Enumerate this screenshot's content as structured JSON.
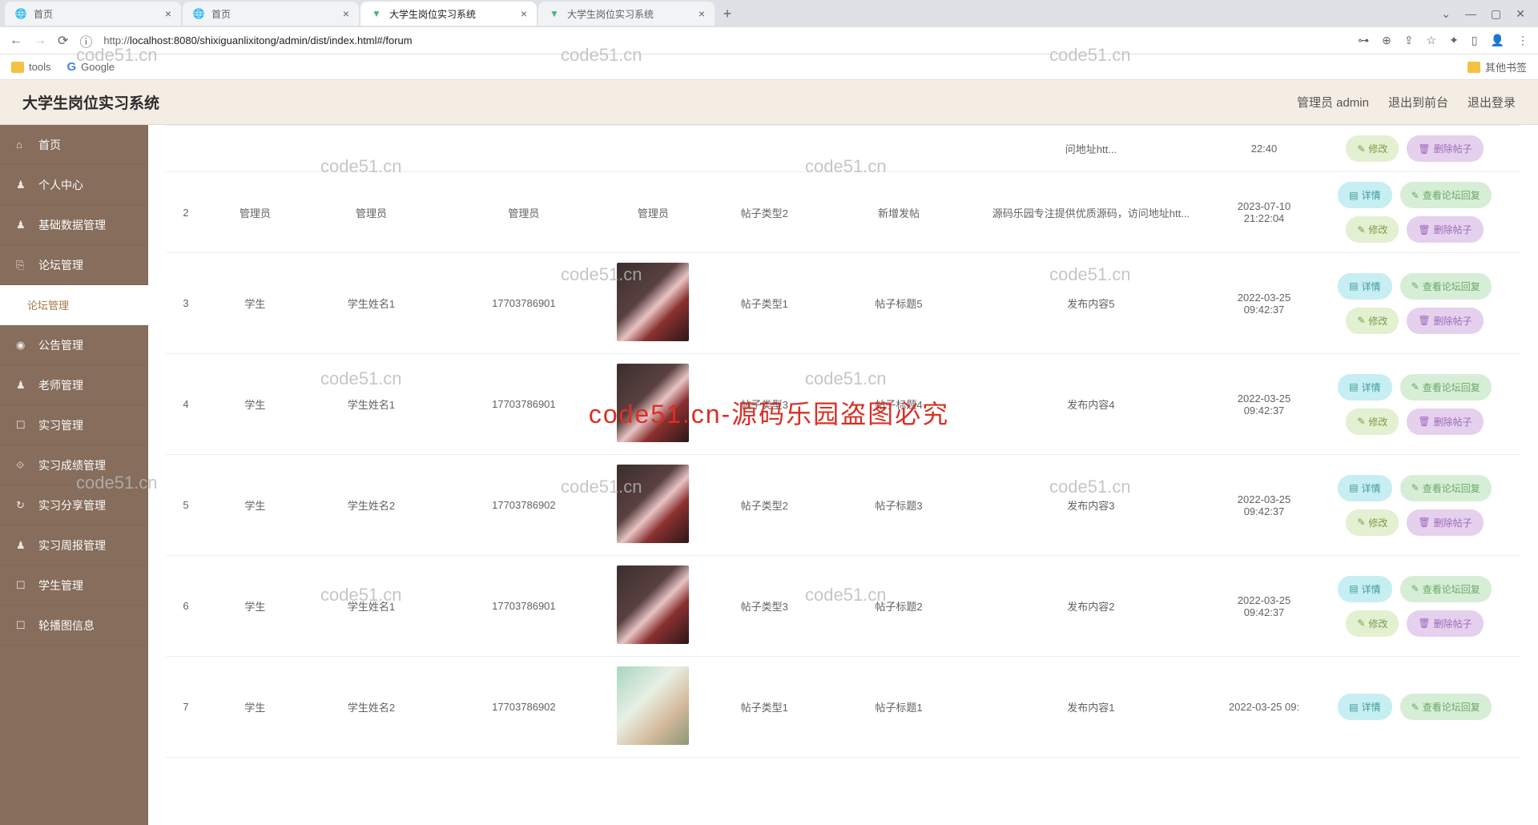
{
  "browser": {
    "tabs": [
      {
        "title": "首页",
        "active": false,
        "icon": "globe"
      },
      {
        "title": "首页",
        "active": false,
        "icon": "globe"
      },
      {
        "title": "大学生岗位实习系统",
        "active": true,
        "icon": "vue"
      },
      {
        "title": "大学生岗位实习系统",
        "active": false,
        "icon": "vue"
      }
    ],
    "url_proto": "http://",
    "url_rest": "localhost:8080/shixiguanlixitong/admin/dist/index.html#/forum",
    "bookmarks": {
      "tools": "tools",
      "google": "Google",
      "other": "其他书签"
    }
  },
  "header": {
    "title": "大学生岗位实习系统",
    "user": "管理员 admin",
    "to_front": "退出到前台",
    "logout": "退出登录"
  },
  "sidebar": {
    "items": [
      {
        "icon": "⌂",
        "label": "首页"
      },
      {
        "icon": "♟",
        "label": "个人中心"
      },
      {
        "icon": "♟",
        "label": "基础数据管理"
      },
      {
        "icon": "⎘",
        "label": "论坛管理"
      }
    ],
    "sub_active": "论坛管理",
    "items2": [
      {
        "icon": "◉",
        "label": "公告管理"
      },
      {
        "icon": "♟",
        "label": "老师管理"
      },
      {
        "icon": "☐",
        "label": "实习管理"
      },
      {
        "icon": "⟐",
        "label": "实习成绩管理"
      },
      {
        "icon": "↻",
        "label": "实习分享管理"
      },
      {
        "icon": "♟",
        "label": "实习周报管理"
      },
      {
        "icon": "☐",
        "label": "学生管理"
      },
      {
        "icon": "☐",
        "label": "轮播图信息"
      }
    ]
  },
  "buttons": {
    "detail": "详情",
    "reply": "查看论坛回复",
    "edit": "修改",
    "delete": "删除帖子"
  },
  "rows": [
    {
      "idx": "",
      "role": "",
      "name": "",
      "phone": "",
      "img": false,
      "type": "",
      "title": "",
      "content": "问地址htt...",
      "time": "22:40",
      "ops": [
        "edit",
        "delete"
      ]
    },
    {
      "idx": "2",
      "role": "管理员",
      "name": "管理员",
      "phone": "管理员",
      "img": false,
      "img_text": "管理员",
      "type": "帖子类型2",
      "title": "新增发帖",
      "content": "源码乐园专注提供优质源码，访问地址htt...",
      "time": "2023-07-10 21:22:04",
      "ops": [
        "detail",
        "reply",
        "edit",
        "delete"
      ]
    },
    {
      "idx": "3",
      "role": "学生",
      "name": "学生姓名1",
      "phone": "17703786901",
      "img": true,
      "type": "帖子类型1",
      "title": "帖子标题5",
      "content": "发布内容5",
      "time": "2022-03-25 09:42:37",
      "ops": [
        "detail",
        "reply",
        "edit",
        "delete"
      ]
    },
    {
      "idx": "4",
      "role": "学生",
      "name": "学生姓名1",
      "phone": "17703786901",
      "img": true,
      "type": "帖子类型3",
      "title": "帖子标题4",
      "content": "发布内容4",
      "time": "2022-03-25 09:42:37",
      "ops": [
        "detail",
        "reply",
        "edit",
        "delete"
      ]
    },
    {
      "idx": "5",
      "role": "学生",
      "name": "学生姓名2",
      "phone": "17703786902",
      "img": true,
      "type": "帖子类型2",
      "title": "帖子标题3",
      "content": "发布内容3",
      "time": "2022-03-25 09:42:37",
      "ops": [
        "detail",
        "reply",
        "edit",
        "delete"
      ]
    },
    {
      "idx": "6",
      "role": "学生",
      "name": "学生姓名1",
      "phone": "17703786901",
      "img": true,
      "type": "帖子类型3",
      "title": "帖子标题2",
      "content": "发布内容2",
      "time": "2022-03-25 09:42:37",
      "ops": [
        "detail",
        "reply",
        "edit",
        "delete"
      ]
    },
    {
      "idx": "7",
      "role": "学生",
      "name": "学生姓名2",
      "phone": "17703786902",
      "img": true,
      "img_alt": true,
      "type": "帖子类型1",
      "title": "帖子标题1",
      "content": "发布内容1",
      "time": "2022-03-25 09:",
      "ops": [
        "detail",
        "reply"
      ]
    }
  ],
  "watermark": {
    "text": "code51.cn",
    "center": "code51.cn-源码乐园盗图必究"
  }
}
